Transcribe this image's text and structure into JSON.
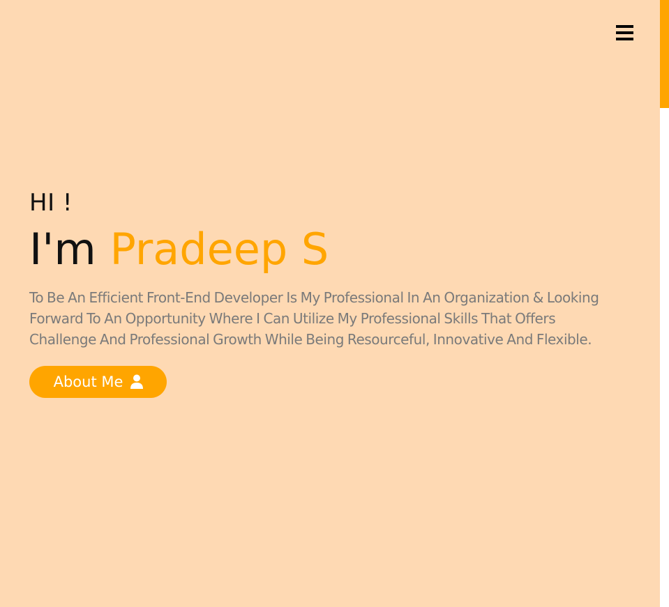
{
  "header": {
    "menu_icon": "hamburger-icon"
  },
  "hero": {
    "greeting": "HI !",
    "intro_prefix": "I'm ",
    "name": "Pradeep S",
    "tagline": "To Be An Efficient Front-End Developer Is My Professional In An Organization & Looking Forward To An Opportunity Where I Can Utilize My Professional Skills That Offers Challenge And Professional Growth While Being Resourceful, Innovative And Flexible.",
    "cta_label": "About Me",
    "cta_icon": "user-icon"
  },
  "colors": {
    "background": "#fed9b3",
    "accent": "#ffa500",
    "text_dark": "#111111",
    "text_muted": "#7a7a7a"
  }
}
